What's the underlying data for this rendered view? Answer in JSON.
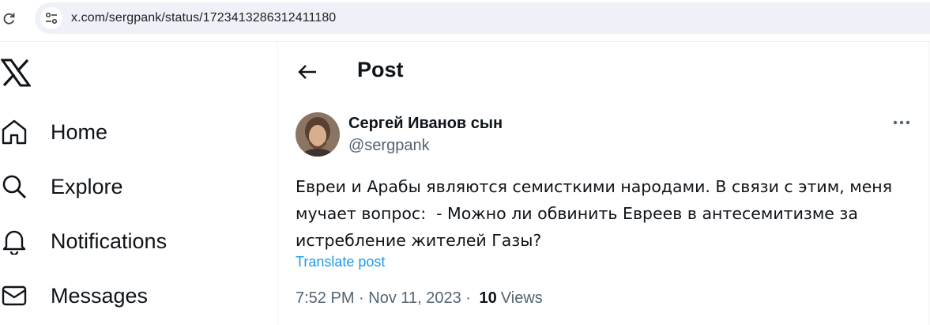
{
  "browser": {
    "url": "x.com/sergpank/status/1723413286312411180"
  },
  "sidebar": {
    "items": [
      {
        "label": "Home",
        "icon": "home-icon"
      },
      {
        "label": "Explore",
        "icon": "search-icon"
      },
      {
        "label": "Notifications",
        "icon": "bell-icon"
      },
      {
        "label": "Messages",
        "icon": "envelope-icon"
      }
    ]
  },
  "header": {
    "title": "Post"
  },
  "post": {
    "author_name": "Сергей Иванов сын",
    "author_handle": "@sergpank",
    "text": "Евреи и Арабы являются семисткими народами. В связи с этим, меня мучает вопрос:  - Можно ли обвинить Евреев в антесемитизме за истребление жителей Газы?",
    "translate_label": "Translate post",
    "timestamp": "7:52 PM · Nov 11, 2023 · ",
    "views_count": "10",
    "views_label": "Views"
  },
  "colors": {
    "accent": "#1d9bf0",
    "text_primary": "#0f1419",
    "text_secondary": "#536471",
    "url_bar": "#eef1f8"
  }
}
